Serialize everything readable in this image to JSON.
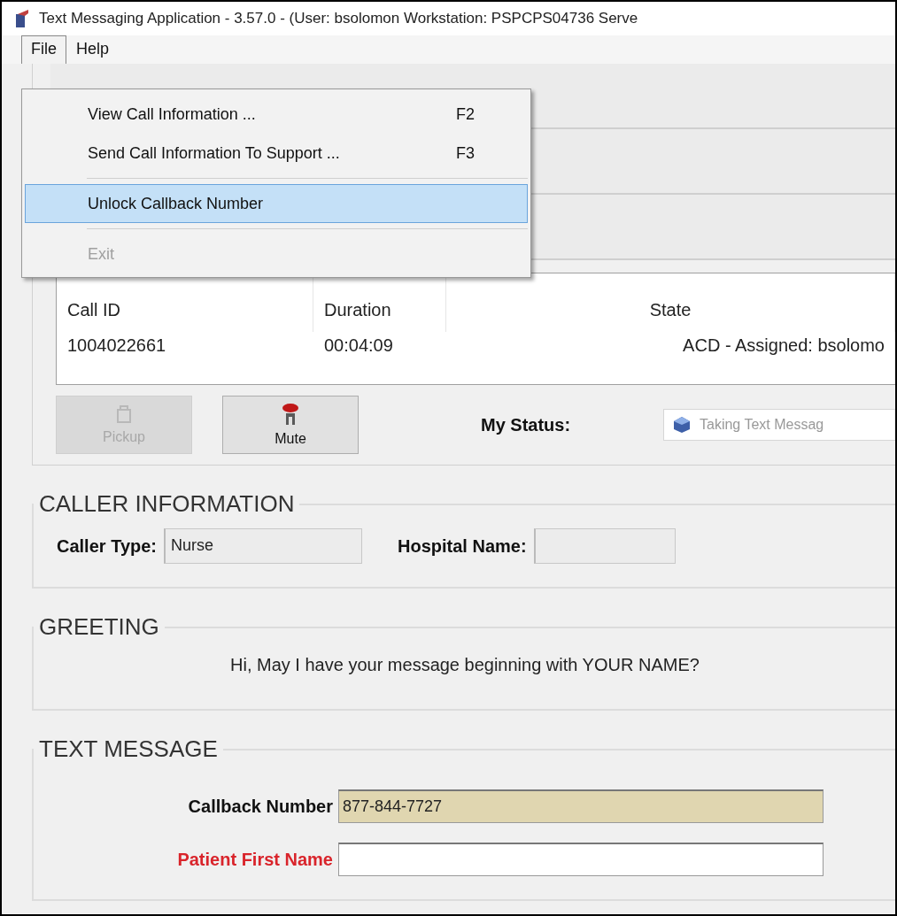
{
  "window": {
    "title": "Text Messaging Application - 3.57.0 -  (User: bsolomon  Workstation: PSPCPS04736  Serve"
  },
  "menu_bar": [
    {
      "label": "File",
      "selected": true
    },
    {
      "label": "Help",
      "selected": false
    }
  ],
  "file_menu": [
    {
      "kind": "item",
      "label": "View Call Information ...",
      "shortcut": "F2",
      "highlighted": false,
      "disabled": false
    },
    {
      "kind": "item",
      "label": "Send Call Information To Support ...",
      "shortcut": "F3",
      "highlighted": false,
      "disabled": false
    },
    {
      "kind": "separator"
    },
    {
      "kind": "item",
      "label": "Unlock Callback Number",
      "highlighted": true,
      "disabled": false
    },
    {
      "kind": "separator"
    },
    {
      "kind": "item",
      "label": "Exit",
      "highlighted": false,
      "disabled": true
    }
  ],
  "call_table": {
    "columns": [
      "Call ID",
      "Duration",
      "State"
    ],
    "rows": [
      [
        "1004022661",
        "00:04:09",
        "ACD - Assigned:  bsolomo"
      ]
    ]
  },
  "call_buttons": [
    {
      "kind": "pickup",
      "label": "Pickup",
      "disabled": true
    },
    {
      "kind": "mute",
      "label": "Mute",
      "disabled": false
    }
  ],
  "my_status": {
    "label": "My Status:",
    "value": "Taking Text Messag"
  },
  "caller_information": {
    "title": "CALLER INFORMATION",
    "fields": [
      {
        "label": "Caller Type:",
        "value": "Nurse"
      },
      {
        "label": "Hospital Name:"
      }
    ]
  },
  "greeting": {
    "title": "GREETING",
    "text": "Hi, May I have your message beginning with YOUR NAME?"
  },
  "text_message": {
    "title": "TEXT MESSAGE",
    "fields": [
      {
        "label": "Callback Number",
        "value": "877-844-7727",
        "required": false,
        "locked": true
      },
      {
        "label": "Patient First Name",
        "required": true,
        "locked": false
      }
    ]
  }
}
